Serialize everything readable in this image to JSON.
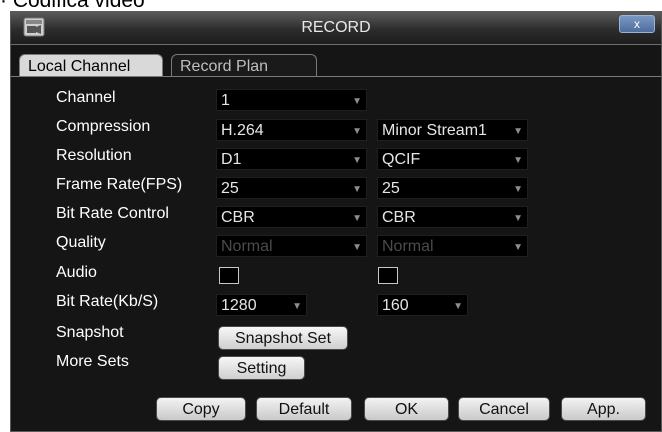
{
  "page_caption": "· Codifica video",
  "window": {
    "title": "RECORD",
    "close_symbol": "x"
  },
  "tabs": [
    "Local Channel",
    "Record Plan"
  ],
  "rows": {
    "channel": {
      "label": "Channel",
      "value": "1"
    },
    "compression": {
      "label": "Compression",
      "main": "H.264",
      "extra": "Minor Stream1"
    },
    "resolution": {
      "label": "Resolution",
      "main": "D1",
      "extra": "QCIF"
    },
    "frame_rate": {
      "label": "Frame Rate(FPS)",
      "main": "25",
      "extra": "25"
    },
    "bit_rate_control": {
      "label": "Bit Rate Control",
      "main": "CBR",
      "extra": "CBR"
    },
    "quality": {
      "label": "Quality",
      "main": "Normal",
      "extra": "Normal"
    },
    "audio": {
      "label": "Audio",
      "main_checked": false,
      "extra_checked": false
    },
    "bit_rate": {
      "label": "Bit Rate(Kb/S)",
      "main": "1280",
      "extra": "160"
    },
    "snapshot": {
      "label": "Snapshot",
      "button": "Snapshot Set"
    },
    "more_sets": {
      "label": "More Sets",
      "button": "Setting"
    }
  },
  "buttons": {
    "copy": "Copy",
    "default": "Default",
    "ok": "OK",
    "cancel": "Cancel",
    "apply": "App."
  },
  "icons": {
    "title_icon": "camera-icon",
    "dropdown": "chevron-down-icon"
  },
  "colors": {
    "window_bg": "#151515",
    "field_bg": "#000000",
    "close_button": "#4e6c9c"
  }
}
